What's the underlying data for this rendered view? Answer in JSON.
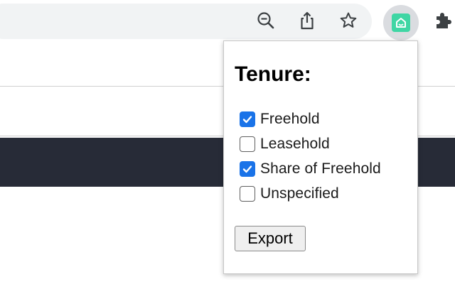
{
  "toolbar": {
    "icons": [
      "zoom-out-icon",
      "share-icon",
      "bookmark-star-icon",
      "extension-house-icon",
      "puzzle-extensions-icon"
    ],
    "extension_accent": "#3fd6a4"
  },
  "popup": {
    "title": "Tenure:",
    "options": [
      {
        "label": "Freehold",
        "checked": true
      },
      {
        "label": "Leasehold",
        "checked": false
      },
      {
        "label": "Share of Freehold",
        "checked": true
      },
      {
        "label": "Unspecified",
        "checked": false
      }
    ],
    "export_label": "Export",
    "checkbox_color": "#1a73e8"
  },
  "page": {
    "band_color": "#272b37"
  }
}
